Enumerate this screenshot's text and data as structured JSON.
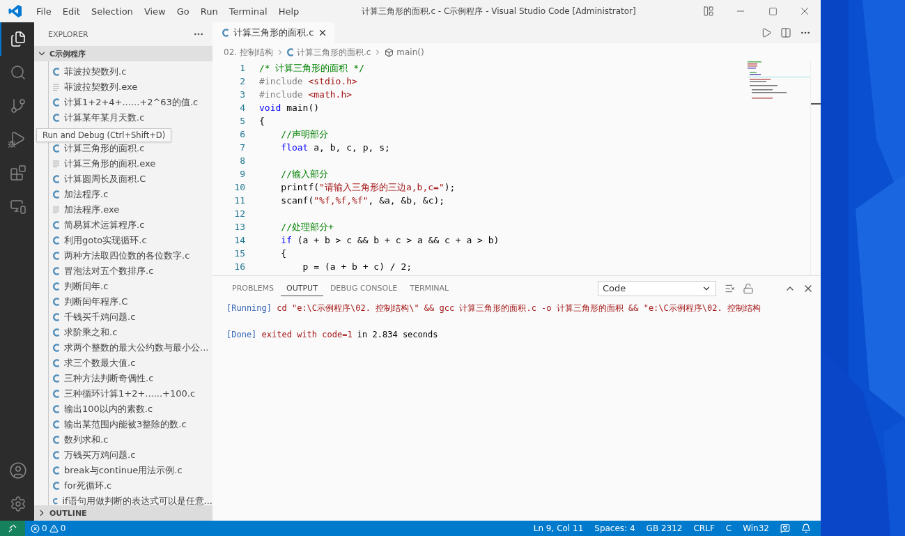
{
  "window": {
    "title": "计算三角形的面积.c - C示例程序 - Visual Studio Code [Administrator]"
  },
  "menu": [
    "File",
    "Edit",
    "Selection",
    "View",
    "Go",
    "Run",
    "Terminal",
    "Help"
  ],
  "activity_bar": [
    {
      "kind": "files",
      "selected": true
    },
    {
      "kind": "search",
      "selected": false
    },
    {
      "kind": "scm",
      "selected": false
    },
    {
      "kind": "debug",
      "selected": false
    },
    {
      "kind": "extensions",
      "selected": false
    },
    {
      "kind": "remote",
      "selected": false
    }
  ],
  "tooltip": "Run and Debug (Ctrl+Shift+D)",
  "explorer": {
    "title": "EXPLORER",
    "folder": {
      "name": "C示例程序",
      "expanded": true
    },
    "files": [
      {
        "name": "菲波拉契数列.c",
        "kind": "c"
      },
      {
        "name": "菲波拉契数列.exe",
        "kind": "exe"
      },
      {
        "name": "计算1+2+4+......+2^63的值.c",
        "kind": "c"
      },
      {
        "name": "计算某年某月天数.c",
        "kind": "c"
      },
      {
        "kind": "hidden"
      },
      {
        "name": "计算三角形的面积.c",
        "kind": "c"
      },
      {
        "name": "计算三角形的面积.exe",
        "kind": "exe"
      },
      {
        "name": "计算圆周长及面积.C",
        "kind": "c"
      },
      {
        "name": "加法程序.c",
        "kind": "c"
      },
      {
        "name": "加法程序.exe",
        "kind": "exe"
      },
      {
        "name": "简易算术运算程序.c",
        "kind": "c"
      },
      {
        "name": "利用goto实现循环.c",
        "kind": "c"
      },
      {
        "name": "两种方法取四位数的各位数字.c",
        "kind": "c"
      },
      {
        "name": "冒泡法对五个数排序.c",
        "kind": "c"
      },
      {
        "name": "判断闰年.c",
        "kind": "c"
      },
      {
        "name": "判断闰年程序.C",
        "kind": "c"
      },
      {
        "name": "千钱买千鸡问题.c",
        "kind": "c"
      },
      {
        "name": "求阶乘之和.c",
        "kind": "c"
      },
      {
        "name": "求两个整数的最大公约数与最小公...",
        "kind": "c"
      },
      {
        "name": "求三个数最大值.c",
        "kind": "c"
      },
      {
        "name": "三种方法判断奇偶性.c",
        "kind": "c"
      },
      {
        "name": "三种循环计算1+2+......+100.c",
        "kind": "c"
      },
      {
        "name": "输出100以内的素数.c",
        "kind": "c"
      },
      {
        "name": "输出某范围内能被3整除的数.c",
        "kind": "c"
      },
      {
        "name": "数列求和.c",
        "kind": "c"
      },
      {
        "name": "万钱买万鸡问题.c",
        "kind": "c"
      },
      {
        "name": "break与continue用法示例.c",
        "kind": "c"
      },
      {
        "name": "for死循环.c",
        "kind": "c"
      },
      {
        "name": "if语句用做判断的表达式可以是任意...",
        "kind": "c"
      }
    ],
    "outline": {
      "title": "OUTLINE",
      "expanded": false
    }
  },
  "editor_tab": {
    "label": "计算三角形的面积.c",
    "selected": true
  },
  "breadcrumb": [
    "02. 控制结构",
    "计算三角形的面积.c",
    "main()"
  ],
  "code": [
    {
      "n": "1",
      "tokens": [
        {
          "t": "/* 计算三角形的面积 */",
          "kind": "comment"
        }
      ]
    },
    {
      "n": "2",
      "tokens": [
        {
          "t": "#include ",
          "kind": "directive"
        },
        {
          "t": "<stdio.h>",
          "kind": "string"
        }
      ]
    },
    {
      "n": "3",
      "tokens": [
        {
          "t": "#include ",
          "kind": "directive"
        },
        {
          "t": "<math.h>",
          "kind": "string"
        }
      ]
    },
    {
      "n": "4",
      "tokens": [
        {
          "t": "void",
          "kind": "keyword"
        },
        {
          "t": " main()",
          "kind": "plain"
        }
      ]
    },
    {
      "n": "5",
      "tokens": [
        {
          "t": "{",
          "kind": "plain"
        }
      ]
    },
    {
      "n": "6",
      "tokens": [
        {
          "t": "    //声明部分",
          "kind": "comment"
        }
      ]
    },
    {
      "n": "7",
      "tokens": [
        {
          "t": "    float",
          "kind": "keyword"
        },
        {
          "t": " a, b, c, p, s;",
          "kind": "plain"
        }
      ]
    },
    {
      "n": "8"
    },
    {
      "n": "9",
      "tokens": [
        {
          "t": "    //输入部分",
          "kind": "comment"
        }
      ]
    },
    {
      "n": "10",
      "tokens": [
        {
          "t": "    printf(",
          "kind": "plain"
        },
        {
          "t": "\"请输入三角形的三边a,b,c=\"",
          "kind": "string"
        },
        {
          "t": ");",
          "kind": "plain"
        }
      ]
    },
    {
      "n": "11",
      "tokens": [
        {
          "t": "    scanf(",
          "kind": "plain"
        },
        {
          "t": "\"%f,%f,%f\"",
          "kind": "string"
        },
        {
          "t": ", &a, &b, &c);",
          "kind": "plain"
        }
      ]
    },
    {
      "n": "12"
    },
    {
      "n": "13",
      "tokens": [
        {
          "t": "    //处理部分+",
          "kind": "comment"
        }
      ]
    },
    {
      "n": "14",
      "tokens": [
        {
          "t": "    if",
          "kind": "keyword"
        },
        {
          "t": " (a + b > c && b + c > a && c + a > b)",
          "kind": "plain"
        }
      ]
    },
    {
      "n": "15",
      "tokens": [
        {
          "t": "    {",
          "kind": "plain"
        }
      ]
    },
    {
      "n": "16",
      "tokens": [
        {
          "t": "        p = (a + b + c) / 2;",
          "kind": "plain"
        }
      ]
    }
  ],
  "panel": {
    "tabs": [
      {
        "label": "PROBLEMS",
        "selected": false
      },
      {
        "label": "OUTPUT",
        "selected": true
      },
      {
        "label": "DEBUG CONSOLE",
        "selected": false
      },
      {
        "label": "TERMINAL",
        "selected": false
      }
    ],
    "channel": "Code",
    "output": [
      {
        "tokens": [
          {
            "t": "[Running]",
            "kind": "tag"
          },
          {
            "t": " cd \"e:\\C示例程序\\02. 控制结构\\\" && gcc 计算三角形的面积.c -o 计算三角形的面积 && \"e:\\C示例程序\\02. 控制结构",
            "kind": "red"
          }
        ]
      },
      {
        "tokens": [
          {
            "t": "[Done]",
            "kind": "tag"
          },
          {
            "t": " exited with code=1",
            "kind": "red"
          },
          {
            "t": " in 2.834 seconds",
            "kind": "plain"
          }
        ]
      }
    ]
  },
  "status_bar": {
    "errors": "0",
    "warnings": "0",
    "items": [
      "Ln 9, Col 11",
      "Spaces: 4",
      "GB 2312",
      "CRLF",
      "C",
      "Win32"
    ]
  }
}
